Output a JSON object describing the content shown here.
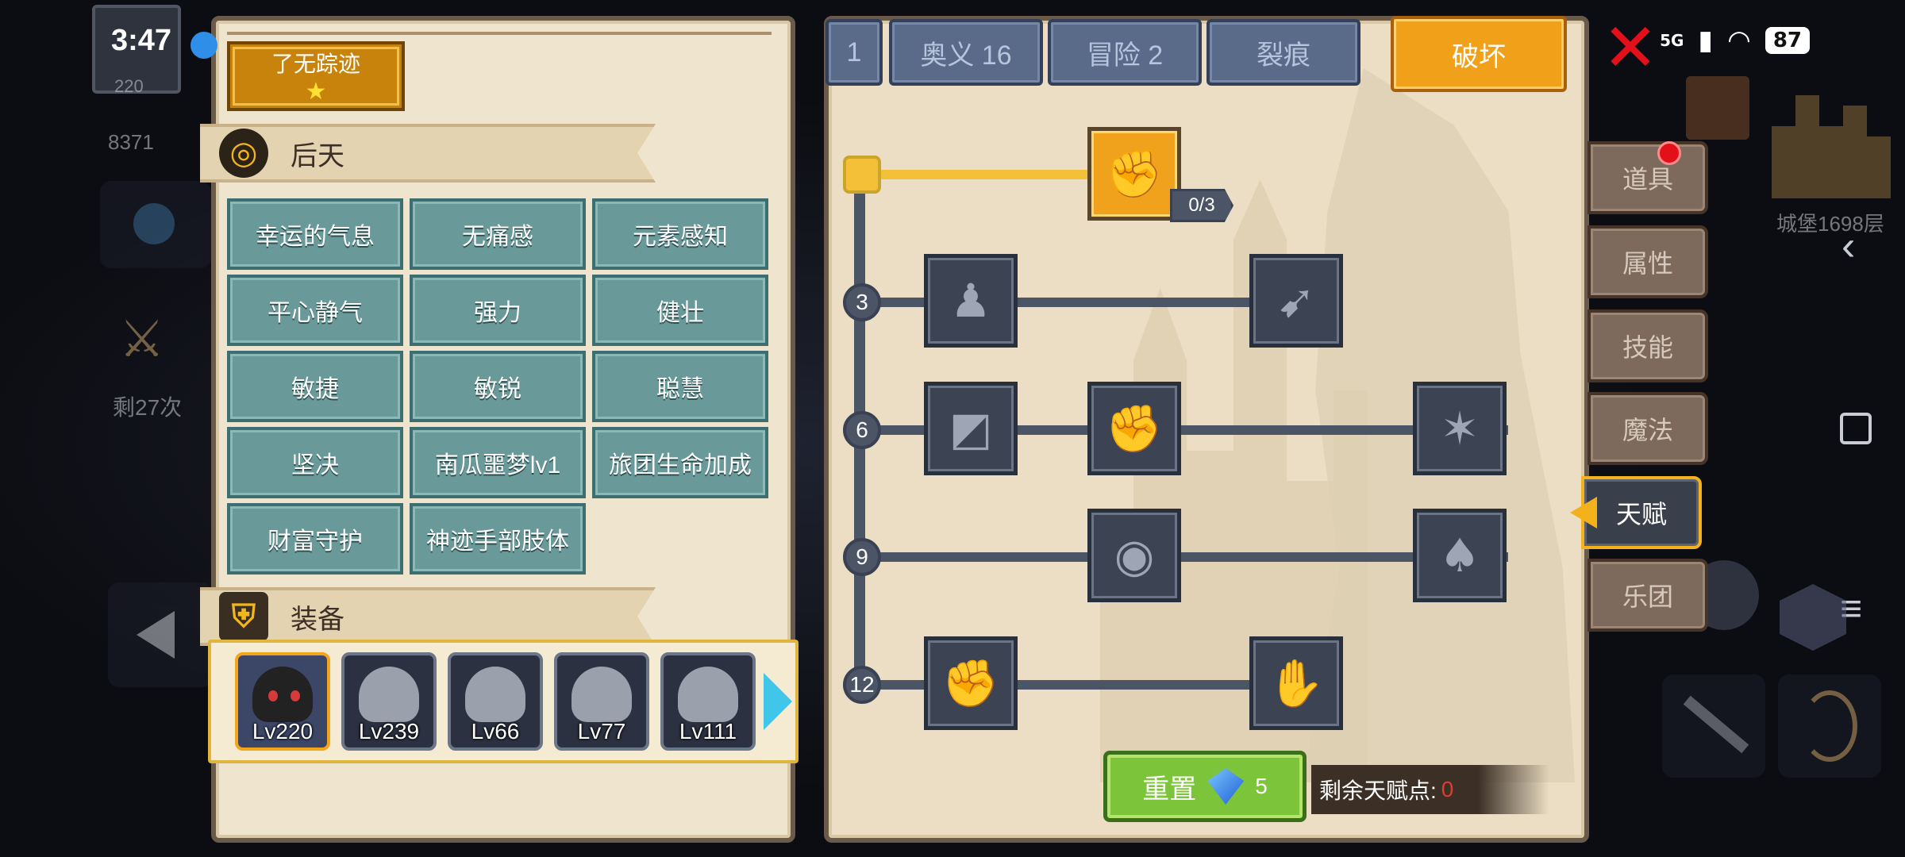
{
  "status_bar": {
    "time": "3:47",
    "network": "5G",
    "battery": "87"
  },
  "left_hud": {
    "stat_value": "8371",
    "remaining": "剩27次",
    "avatar_level": "220"
  },
  "right_hud": {
    "floor": "城堡1698层"
  },
  "character": {
    "title": "了无踪迹",
    "title_star": "★"
  },
  "innate_section": {
    "label": "后天",
    "skills": [
      "幸运的气息",
      "无痛感",
      "元素感知",
      "平心静气",
      "强力",
      "健壮",
      "敏捷",
      "敏锐",
      "聪慧",
      "坚决",
      "南瓜噩梦lv1",
      "旅团生命加成",
      "财富守护",
      "神迹手部肢体"
    ]
  },
  "equipment_section": {
    "label": "装备",
    "slots": [
      {
        "level": "Lv220",
        "active": true
      },
      {
        "level": "Lv239",
        "active": false
      },
      {
        "level": "Lv66",
        "active": false
      },
      {
        "level": "Lv77",
        "active": false
      },
      {
        "level": "Lv111",
        "active": false
      }
    ]
  },
  "tabs": [
    {
      "label": "1",
      "active": false
    },
    {
      "label": "奥义 16",
      "active": false
    },
    {
      "label": "冒险 2",
      "active": false
    },
    {
      "label": "裂痕",
      "active": false
    },
    {
      "label": "破坏",
      "active": true
    }
  ],
  "talent_tree": {
    "root_talent": {
      "icon": "arm-wrestle-icon",
      "count": "0/3"
    },
    "tiers": [
      {
        "level": "3",
        "talents": [
          "muscle-body-icon",
          "arrow-slash-icon"
        ]
      },
      {
        "level": "6",
        "talents": [
          "shield-break-icon",
          "fist-punch-icon",
          "splash-strike-icon"
        ]
      },
      {
        "level": "9",
        "talents": [
          "ring-drop-icon",
          "bat-wing-icon"
        ]
      },
      {
        "level": "12",
        "talents": [
          "raised-fist-icon",
          "hand-grip-icon"
        ]
      }
    ]
  },
  "reset": {
    "label": "重置",
    "cost": "5"
  },
  "talent_points": {
    "label": "剩余天赋点:",
    "value": "0"
  },
  "side_menu": [
    {
      "label": "道具",
      "active": false
    },
    {
      "label": "属性",
      "active": false
    },
    {
      "label": "技能",
      "active": false
    },
    {
      "label": "魔法",
      "active": false
    },
    {
      "label": "天赋",
      "active": true
    },
    {
      "label": "乐团",
      "active": false
    }
  ],
  "colors": {
    "accent_gold": "#f1a01a",
    "tab_blue": "#5a6b8a",
    "skill_teal": "#6a999a",
    "reset_green": "#7cc43a",
    "points_red": "#e23b2e"
  }
}
